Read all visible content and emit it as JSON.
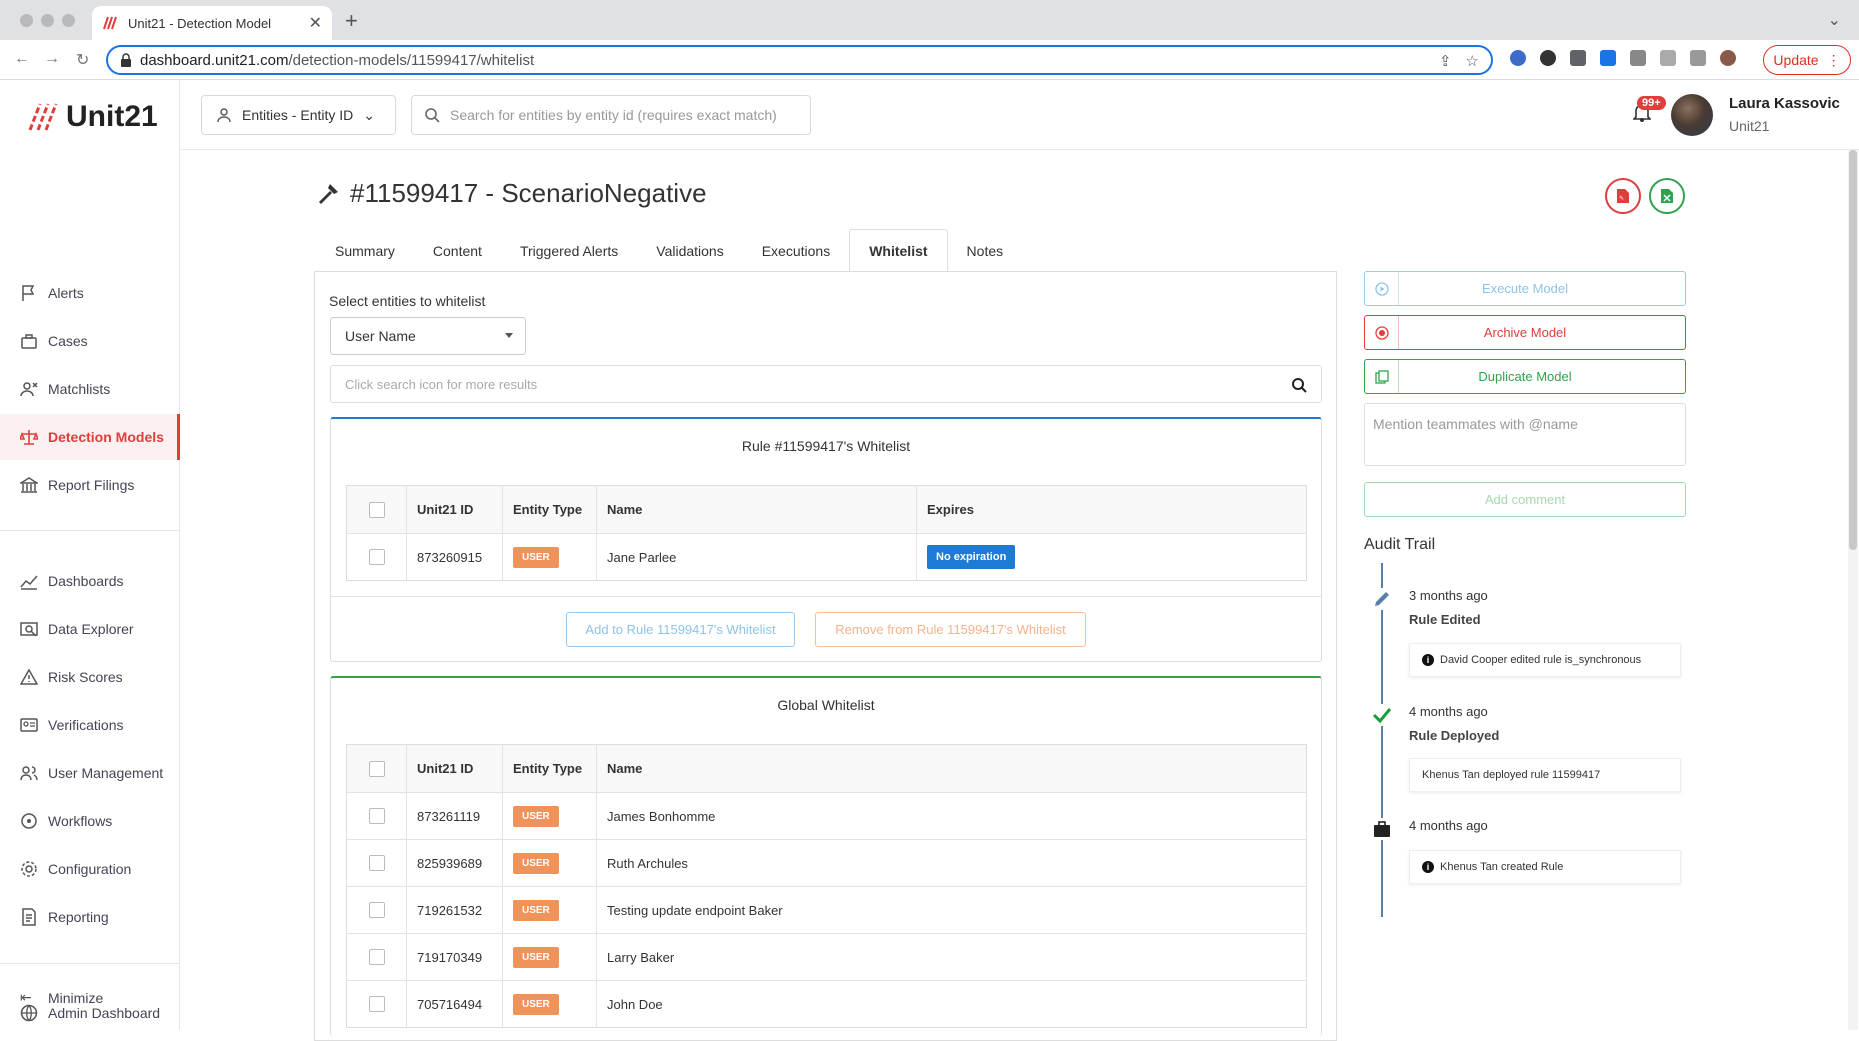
{
  "browser": {
    "tab_title": "Unit21 - Detection Model",
    "url_domain": "dashboard.unit21.com",
    "url_path": "/detection-models/11599417/whitelist",
    "update_label": "Update"
  },
  "sidebar": {
    "logo_text": "Unit21",
    "items": [
      {
        "label": "Alerts",
        "icon": "flag-icon"
      },
      {
        "label": "Cases",
        "icon": "briefcase-icon"
      },
      {
        "label": "Matchlists",
        "icon": "user-x-icon"
      },
      {
        "label": "Detection Models",
        "icon": "scale-icon",
        "active": true
      },
      {
        "label": "Report Filings",
        "icon": "bank-icon"
      },
      {
        "label": "Dashboards",
        "icon": "chart-line-icon"
      },
      {
        "label": "Data Explorer",
        "icon": "search-data-icon"
      },
      {
        "label": "Risk Scores",
        "icon": "warning-icon"
      },
      {
        "label": "Verifications",
        "icon": "id-card-icon"
      },
      {
        "label": "User Management",
        "icon": "users-icon"
      },
      {
        "label": "Workflows",
        "icon": "workflow-icon"
      },
      {
        "label": "Configuration",
        "icon": "gear-icon"
      },
      {
        "label": "Reporting",
        "icon": "report-icon"
      },
      {
        "label": "Admin Dashboard",
        "icon": "globe-icon"
      }
    ],
    "minimize_label": "Minimize"
  },
  "topbar": {
    "entity_selector": "Entities - Entity ID",
    "search_placeholder": "Search for entities by entity id (requires exact match)",
    "notification_count": "99+",
    "user_name": "Laura Kassovic",
    "user_org": "Unit21"
  },
  "page": {
    "title": "#11599417 - ScenarioNegative",
    "tabs": [
      "Summary",
      "Content",
      "Triggered Alerts",
      "Validations",
      "Executions",
      "Whitelist",
      "Notes"
    ],
    "active_tab": "Whitelist"
  },
  "whitelist": {
    "select_label": "Select entities to whitelist",
    "select_value": "User Name",
    "search_placeholder": "Click search icon for more results",
    "rule_card": {
      "title": "Rule #11599417's Whitelist",
      "headers": [
        "Unit21 ID",
        "Entity Type",
        "Name",
        "Expires"
      ],
      "rows": [
        {
          "id": "873260915",
          "type": "USER",
          "name": "Jane Parlee",
          "expires": "No expiration"
        }
      ],
      "add_button": "Add to Rule 11599417's Whitelist",
      "remove_button": "Remove from Rule 11599417's Whitelist"
    },
    "global_card": {
      "title": "Global Whitelist",
      "headers": [
        "Unit21 ID",
        "Entity Type",
        "Name"
      ],
      "rows": [
        {
          "id": "873261119",
          "type": "USER",
          "name": "James Bonhomme"
        },
        {
          "id": "825939689",
          "type": "USER",
          "name": "Ruth Archules"
        },
        {
          "id": "719261532",
          "type": "USER",
          "name": "Testing update endpoint Baker"
        },
        {
          "id": "719170349",
          "type": "USER",
          "name": "Larry Baker"
        },
        {
          "id": "705716494",
          "type": "USER",
          "name": "John Doe"
        }
      ]
    }
  },
  "actions": {
    "execute": "Execute Model",
    "archive": "Archive Model",
    "duplicate": "Duplicate Model",
    "comment_placeholder": "Mention teammates with @name",
    "add_comment": "Add comment"
  },
  "audit": {
    "title": "Audit Trail",
    "events": [
      {
        "time": "3 months ago",
        "event": "Rule Edited",
        "detail": "David Cooper edited rule is_synchronous",
        "icon": "pencil-icon"
      },
      {
        "time": "4 months ago",
        "event": "Rule Deployed",
        "detail": "Khenus Tan deployed rule 11599417",
        "icon": "check-icon"
      },
      {
        "time": "4 months ago",
        "event": "",
        "detail": "Khenus Tan created Rule",
        "icon": "briefcase-icon"
      }
    ]
  },
  "colors": {
    "brand_red": "#e03d3d",
    "tag_orange": "#f0935a",
    "expiry_blue": "#1f7ad4",
    "action_blue": "#8ec3e8",
    "action_green": "#2ea44f"
  }
}
